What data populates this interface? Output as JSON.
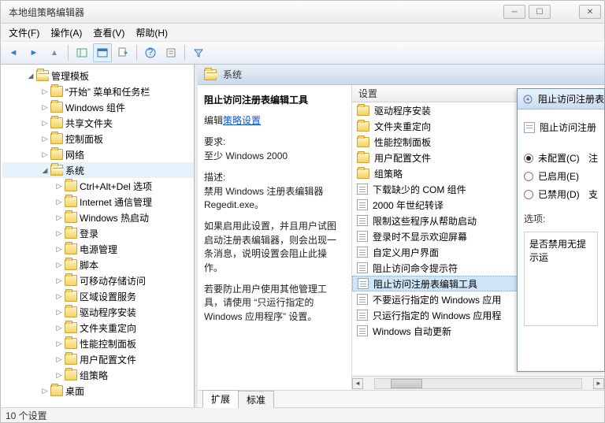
{
  "window": {
    "title": "本地组策略编辑器"
  },
  "menubar": {
    "file": "文件(F)",
    "action": "操作(A)",
    "view": "查看(V)",
    "help": "帮助(H)"
  },
  "tree": {
    "root": "管理模板",
    "items": [
      "“开始” 菜单和任务栏",
      "Windows 组件",
      "共享文件夹",
      "控制面板",
      "网络",
      "系统"
    ],
    "system_children": [
      "Ctrl+Alt+Del 选项",
      "Internet 通信管理",
      "Windows 热启动",
      "登录",
      "电源管理",
      "脚本",
      "可移动存储访问",
      "区域设置服务",
      "驱动程序安装",
      "文件夹重定向",
      "性能控制面板",
      "用户配置文件",
      "组策略"
    ],
    "after": "桌面"
  },
  "right_header": "系统",
  "desc": {
    "title": "阻止访问注册表编辑工具",
    "edit_prefix": "编辑",
    "edit_link": "策略设置",
    "req_label": "要求:",
    "req_value": "至少 Windows 2000",
    "d_label": "描述:",
    "d_line1": "禁用 Windows 注册表编辑器 Regedit.exe。",
    "d_line2": "如果启用此设置，并且用户试图启动注册表编辑器，则会出现一条消息，说明设置会阻止此操作。",
    "d_line3": "若要防止用户使用其他管理工具，请使用 “只运行指定的 Windows 应用程序” 设置。"
  },
  "colhdr": "设置",
  "settings": [
    {
      "t": "folder",
      "label": "驱动程序安装"
    },
    {
      "t": "folder",
      "label": "文件夹重定向"
    },
    {
      "t": "folder",
      "label": "性能控制面板"
    },
    {
      "t": "folder",
      "label": "用户配置文件"
    },
    {
      "t": "folder",
      "label": "组策略"
    },
    {
      "t": "doc",
      "label": "下载缺少的 COM 组件"
    },
    {
      "t": "doc",
      "label": "2000 年世纪转译"
    },
    {
      "t": "doc",
      "label": "限制这些程序从帮助启动"
    },
    {
      "t": "doc",
      "label": "登录时不显示欢迎屏幕"
    },
    {
      "t": "doc",
      "label": "自定义用户界面"
    },
    {
      "t": "doc",
      "label": "阻止访问命令提示符"
    },
    {
      "t": "doc",
      "label": "阻止访问注册表编辑工具",
      "sel": true
    },
    {
      "t": "doc",
      "label": "不要运行指定的 Windows 应用"
    },
    {
      "t": "doc",
      "label": "只运行指定的 Windows 应用程"
    },
    {
      "t": "doc",
      "label": "Windows 自动更新"
    }
  ],
  "tabs": {
    "extended": "扩展",
    "standard": "标准"
  },
  "status": "10 个设置",
  "dialog": {
    "title": "阻止访问注册表",
    "row_label": "阻止访问注册",
    "r1": "未配置(C)",
    "r2": "已启用(E)",
    "r3": "已禁用(D)",
    "side_char1": "注",
    "side_char2": "支",
    "opts_label": "选项:",
    "box_text": "是否禁用无提示运"
  }
}
